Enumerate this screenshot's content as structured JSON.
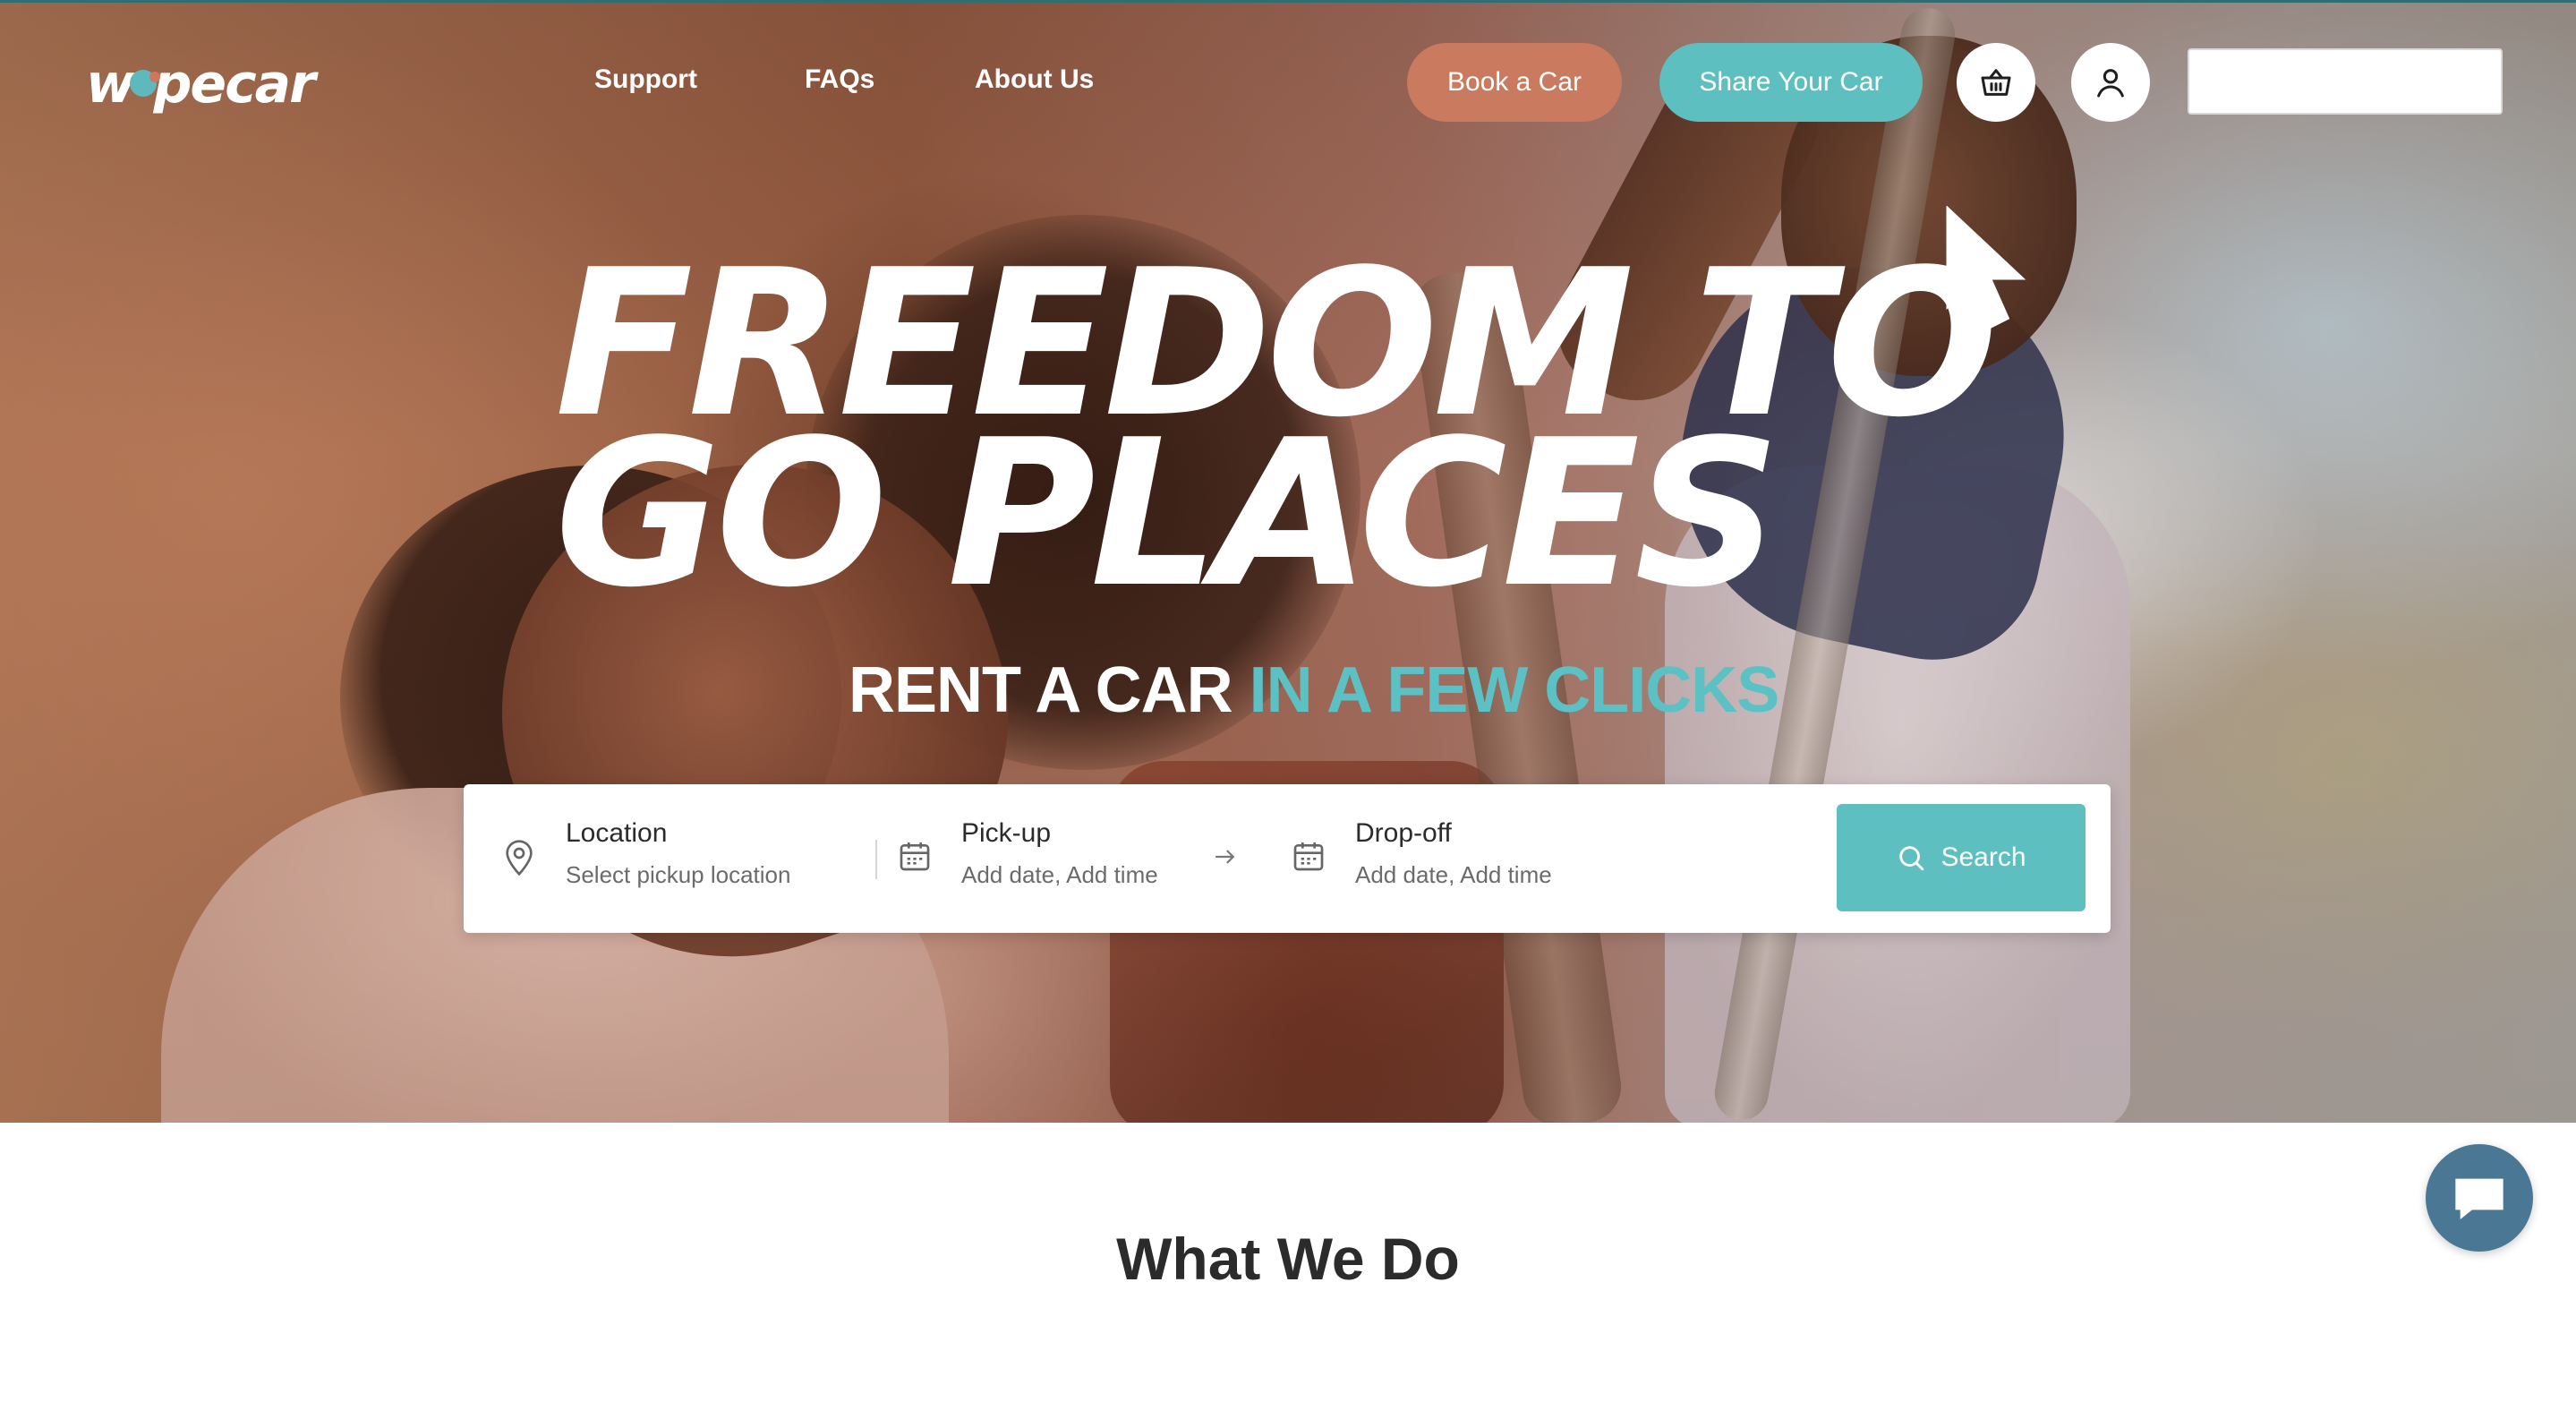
{
  "brand": {
    "logo_text_a": "w",
    "logo_text_b": "pecar"
  },
  "nav": {
    "links": [
      "Support",
      "FAQs",
      "About Us"
    ],
    "book_button": "Book a Car",
    "share_button": "Share Your Car"
  },
  "hero": {
    "headline_line1": "FREEDOM TO",
    "headline_line2": "GO PLACES",
    "sub_white": "RENT A CAR",
    "sub_teal": "IN A FEW CLICKS"
  },
  "search": {
    "location_label": "Location",
    "location_hint": "Select pickup location",
    "pickup_label": "Pick-up",
    "pickup_hint": "Add date, Add time",
    "dropoff_label": "Drop-off",
    "dropoff_hint": "Add date, Add time",
    "button_label": "Search"
  },
  "section": {
    "title": "What We Do"
  },
  "colors": {
    "teal": "#5dbfc0",
    "terracotta": "#c97a5f",
    "chat_blue": "#4a7894",
    "text_dark": "#2b2b2b"
  },
  "icons": {
    "basket": "basket-icon",
    "user": "user-icon",
    "location": "map-pin-icon",
    "pickup": "calendar-icon",
    "dropoff": "calendar-icon",
    "arrow": "arrow-right-icon",
    "search": "search-icon",
    "chat": "chat-icon"
  }
}
